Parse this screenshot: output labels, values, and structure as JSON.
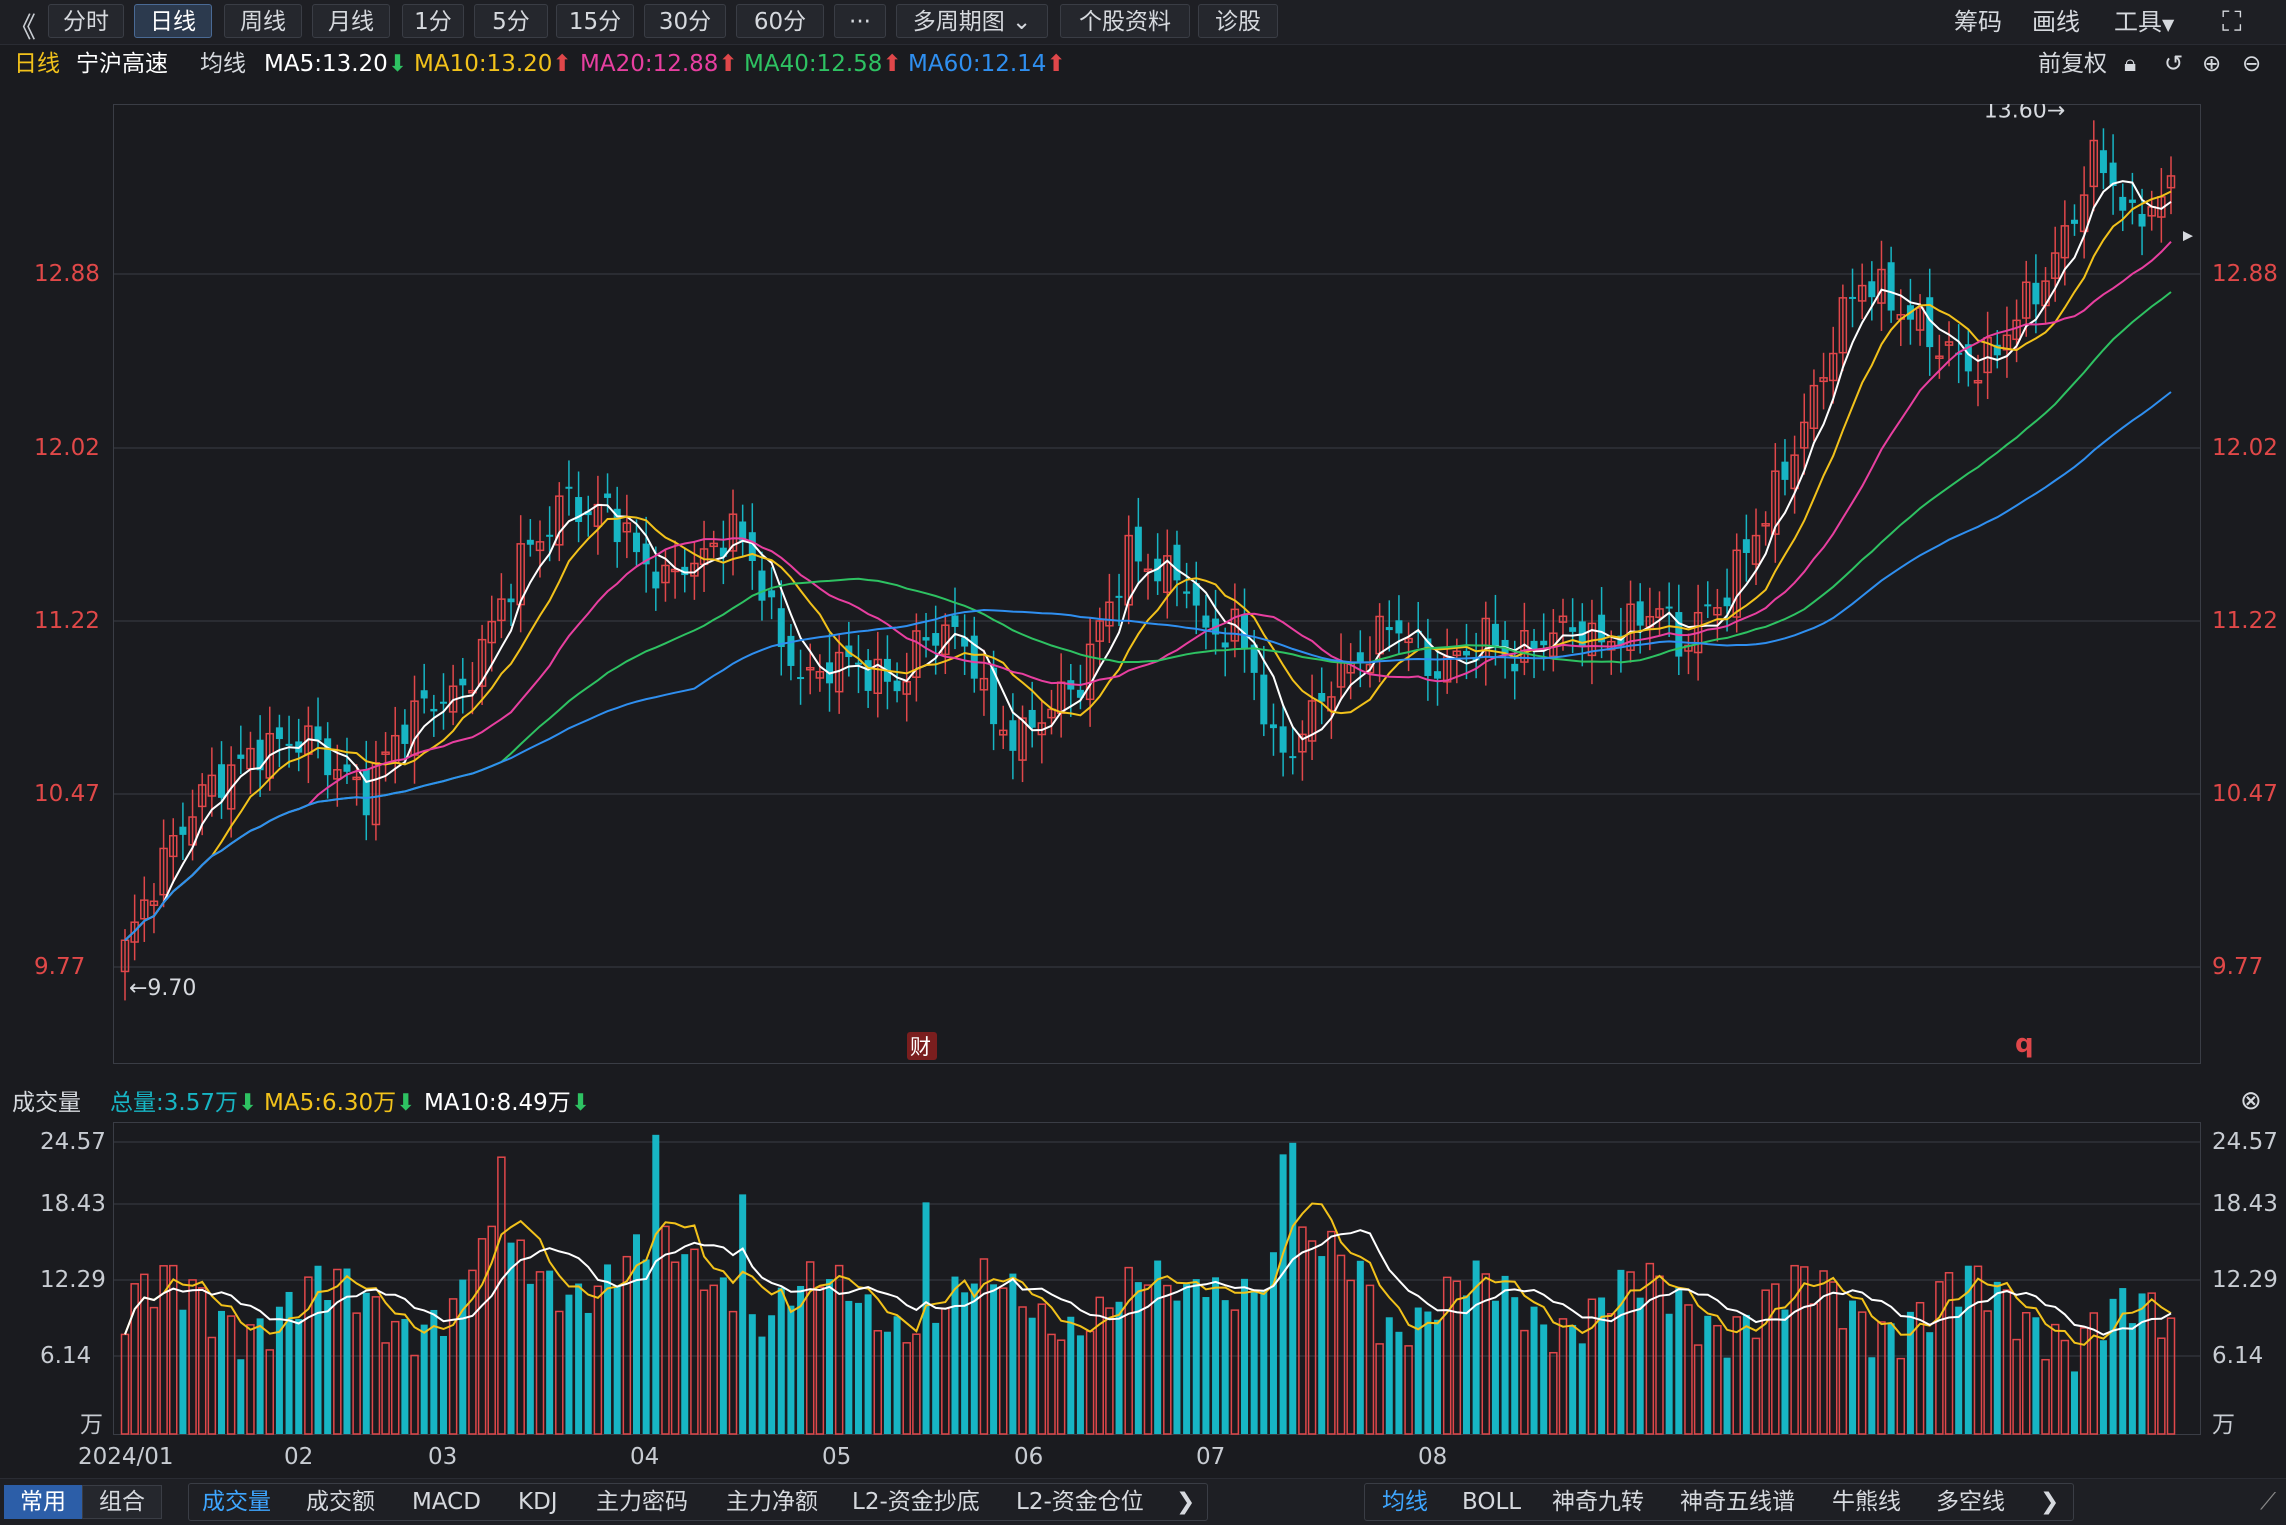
{
  "toolbar": {
    "tabs": [
      {
        "label": "分时",
        "active": false
      },
      {
        "label": "日线",
        "active": true
      },
      {
        "label": "周线",
        "active": false
      },
      {
        "label": "月线",
        "active": false
      },
      {
        "label": "1分",
        "active": false
      },
      {
        "label": "5分",
        "active": false
      },
      {
        "label": "15分",
        "active": false
      },
      {
        "label": "30分",
        "active": false
      },
      {
        "label": "60分",
        "active": false
      }
    ],
    "more_label": "···",
    "multi_period_label": "多周期图",
    "stock_info_label": "个股资料",
    "diagnose_label": "诊股",
    "chips_label": "筹码",
    "draw_label": "画线",
    "tools_label": "工具"
  },
  "title_row": {
    "period": "日线",
    "stock_name": "宁沪高速",
    "ma_label": "均线",
    "ma5": "MA5:13.20",
    "ma10": "MA10:13.20",
    "ma20": "MA20:12.88",
    "ma40": "MA40:12.58",
    "ma60": "MA60:12.14",
    "adjust_label": "前复权"
  },
  "colors": {
    "up": "#e0474a",
    "down": "#17b5c4",
    "ma5": "#ffffff",
    "ma10": "#f2c21b",
    "ma20": "#e83fa0",
    "ma40": "#2ec262",
    "ma60": "#2f8ff0",
    "vol_ma5": "#f2c21b",
    "vol_ma10": "#ffffff"
  },
  "price_axis": {
    "ticks": [
      "12.88",
      "12.02",
      "11.22",
      "10.47",
      "9.77"
    ]
  },
  "annotations": {
    "high": "13.60",
    "low": "9.70",
    "fin_marker": "财",
    "q_marker": "q"
  },
  "volume": {
    "label": "成交量",
    "total": "总量:3.57万",
    "ma5": "MA5:6.30万",
    "ma10": "MA10:8.49万",
    "ticks": [
      "24.57",
      "18.43",
      "12.29",
      "6.14"
    ],
    "unit": "万"
  },
  "x_axis": {
    "labels": [
      "2024/01",
      "02",
      "03",
      "04",
      "05",
      "06",
      "07",
      "08"
    ]
  },
  "bottom_bar": {
    "seg": [
      "常用",
      "组合"
    ],
    "indicators": [
      "成交量",
      "成交额",
      "MACD",
      "KDJ",
      "主力密码",
      "主力净额",
      "L2-资金抄底",
      "L2-资金仓位"
    ],
    "overlays": [
      "均线",
      "BOLL",
      "神奇九转",
      "神奇五线谱",
      "牛熊线",
      "多空线"
    ]
  }
}
